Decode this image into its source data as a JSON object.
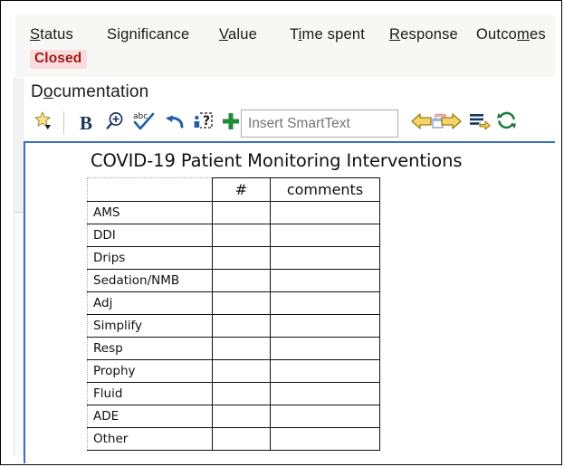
{
  "header": {
    "columns": [
      {
        "pre": "",
        "accel": "S",
        "post": "tatus"
      },
      {
        "pre": "Si",
        "accel": "g",
        "post": "nificance"
      },
      {
        "pre": "",
        "accel": "V",
        "post": "alue"
      },
      {
        "pre": "T",
        "accel": "i",
        "post": "me spent"
      },
      {
        "pre": "",
        "accel": "R",
        "post": "esponse"
      },
      {
        "pre": "Outco",
        "accel": "m",
        "post": "es"
      }
    ],
    "status_value": "Closed",
    "status_bg": "#fadcdc",
    "status_color": "#9e1b1b"
  },
  "documentation": {
    "title_pre": "D",
    "title_accel": "o",
    "title_post": "cumentation"
  },
  "toolbar": {
    "items": [
      {
        "name": "favorites-star-icon",
        "label": "Favorites"
      },
      {
        "name": "bold-button",
        "label": "B"
      },
      {
        "name": "zoom-in-icon",
        "label": "Zoom"
      },
      {
        "name": "spell-check-icon",
        "label": "Spell Check"
      },
      {
        "name": "undo-icon",
        "label": "Undo"
      },
      {
        "name": "patient-query-icon",
        "label": "Patient Query"
      },
      {
        "name": "add-icon",
        "label": "Add"
      }
    ],
    "smarttext_placeholder": "Insert SmartText",
    "smarttext_value": "",
    "nav_items": [
      {
        "name": "back-arrow-icon",
        "label": "Back"
      },
      {
        "name": "forward-arrow-icon",
        "label": "Forward"
      },
      {
        "name": "list-next-icon",
        "label": "Next List Item"
      },
      {
        "name": "refresh-icon",
        "label": "Refresh"
      }
    ],
    "accent_yellow": "#d2a70a",
    "accent_green": "#1f8a3b",
    "accent_blue": "#17365d"
  },
  "note": {
    "title": "COVID-19 Patient Monitoring Interventions",
    "table": {
      "headers": [
        "",
        "#",
        "comments"
      ],
      "rows": [
        {
          "label": "AMS",
          "num": "",
          "comments": ""
        },
        {
          "label": "DDI",
          "num": "",
          "comments": ""
        },
        {
          "label": "Drips",
          "num": "",
          "comments": ""
        },
        {
          "label": "Sedation/NMB",
          "num": "",
          "comments": ""
        },
        {
          "label": "Adj",
          "num": "",
          "comments": ""
        },
        {
          "label": "Simplify",
          "num": "",
          "comments": ""
        },
        {
          "label": "Resp",
          "num": "",
          "comments": ""
        },
        {
          "label": "Prophy",
          "num": "",
          "comments": ""
        },
        {
          "label": "Fluid",
          "num": "",
          "comments": ""
        },
        {
          "label": "ADE",
          "num": "",
          "comments": ""
        },
        {
          "label": "Other",
          "num": "",
          "comments": ""
        }
      ]
    }
  }
}
